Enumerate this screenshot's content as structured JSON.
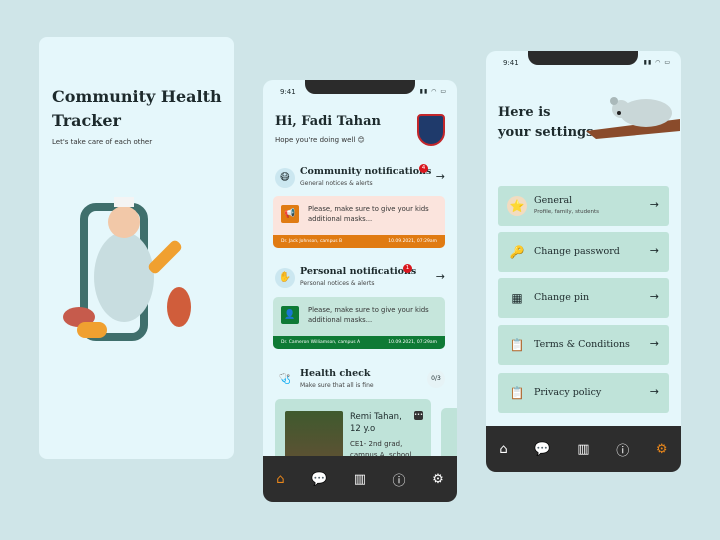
{
  "intro": {
    "title": "Community Health Tracker",
    "subtitle": "Let's take care of each other"
  },
  "home": {
    "time": "9:41",
    "greeting": "Hi, Fadi Tahan",
    "sub": "Hope you're doing well 😊",
    "community": {
      "title": "Community notifications",
      "sub": "General notices & alerts",
      "count": "4",
      "message": "Please, make sure to give your kids additional masks...",
      "author": "Dr. Jack Johnson, campus B",
      "date": "10.09.2021, 07:29am",
      "color": "#e07b12"
    },
    "personal": {
      "title": "Personal notifications",
      "sub": "Personal notices & alerts",
      "count": "1",
      "message": "Please, make sure to give your kids additional masks...",
      "author": "Dr. Cameron Williamson, campus A",
      "date": "10.09.2021, 07:29am",
      "color": "#0e7a35"
    },
    "health": {
      "title": "Health check",
      "sub": "Make sure that all is fine",
      "progress": "0/3",
      "kid_name": "Remi Tahan, 12 y.o",
      "kid_class": "CE1- 2nd grad, campus A, school"
    }
  },
  "settings": {
    "time": "9:41",
    "title_line1": "Here is",
    "title_line2": "your settings",
    "items": [
      {
        "label": "General",
        "sub": "Profile, family, students"
      },
      {
        "label": "Change password"
      },
      {
        "label": "Change pin"
      },
      {
        "label": "Terms & Conditions"
      },
      {
        "label": "Privacy policy"
      }
    ]
  },
  "nav": [
    "home-icon",
    "chat-icon",
    "stats-icon",
    "info-icon",
    "settings-icon"
  ],
  "accent": "#e8861b"
}
